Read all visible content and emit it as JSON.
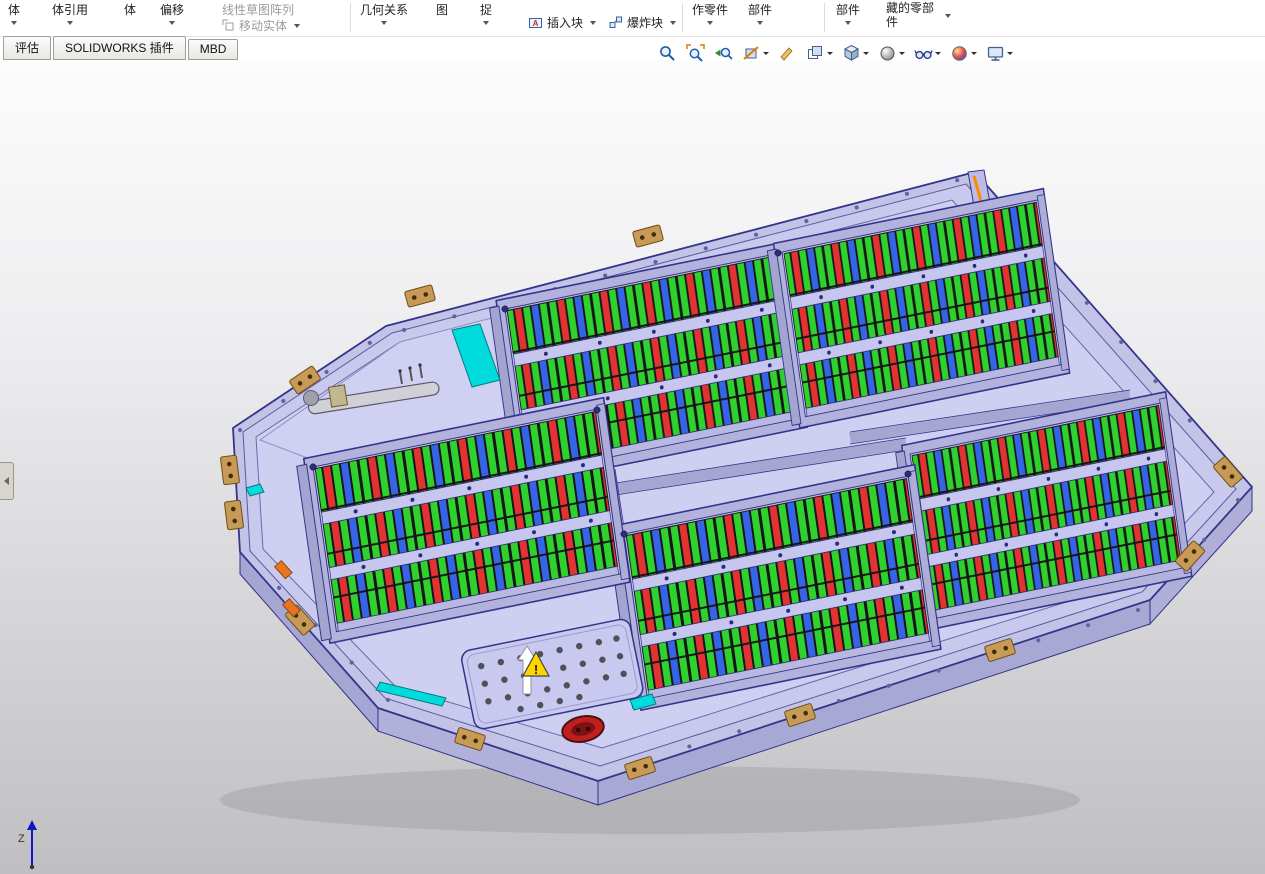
{
  "ribbon": {
    "items": [
      {
        "label": "体",
        "caret": "below"
      },
      {
        "label": "体引用",
        "caret": "below"
      },
      {
        "label": "体",
        "caret": "none"
      },
      {
        "label": "偏移",
        "caret": "below"
      },
      {
        "label": "线性草图阵列",
        "caret": "none",
        "disabled": true
      },
      {
        "label": "移动实体",
        "caret": "right",
        "disabled": true
      },
      {
        "label": "几何关系",
        "caret": "below"
      },
      {
        "label": "图",
        "caret": "none"
      },
      {
        "label": "捉",
        "caret": "below"
      },
      {
        "label": "插入块",
        "caret": "right"
      },
      {
        "label": "爆炸块",
        "caret": "right"
      },
      {
        "label": "作零件",
        "caret": "below"
      },
      {
        "label": "部件",
        "caret": "below"
      },
      {
        "label": "部件",
        "caret": "below"
      },
      {
        "label": "藏的零部件",
        "caret": "right"
      }
    ]
  },
  "tabs": {
    "items": [
      {
        "label": "评估"
      },
      {
        "label": "SOLIDWORKS 插件"
      },
      {
        "label": "MBD"
      }
    ]
  },
  "headsup": {
    "tools": [
      {
        "name": "zoom-fit",
        "caret": false
      },
      {
        "name": "zoom-area",
        "caret": false
      },
      {
        "name": "previous-view",
        "caret": false
      },
      {
        "name": "section-view",
        "caret": true
      },
      {
        "name": "annotation-view",
        "caret": false
      },
      {
        "name": "view-selector",
        "caret": true
      },
      {
        "name": "view-orientation",
        "caret": true
      },
      {
        "name": "display-style",
        "caret": true
      },
      {
        "name": "hide-show-items",
        "caret": true
      },
      {
        "name": "edit-appearance",
        "caret": true
      },
      {
        "name": "view-settings",
        "caret": true
      }
    ]
  },
  "viewport": {
    "model": "battery-pack-3d-assembly",
    "triad": {
      "z_label": "Z"
    },
    "warning_symbol": "!",
    "colors": {
      "tray": "#c3c3e8",
      "outline": "#34348a",
      "cell_green": "#2fd12f",
      "cell_red": "#e23232",
      "cell_blue": "#3565e6",
      "coolant_cyan": "#00dcdc",
      "bracket_tan": "#c89a58",
      "warning_yellow": "#ffd400",
      "connector_red": "#bf1f1f",
      "edge_highlight_orange": "#ff8a00"
    }
  }
}
